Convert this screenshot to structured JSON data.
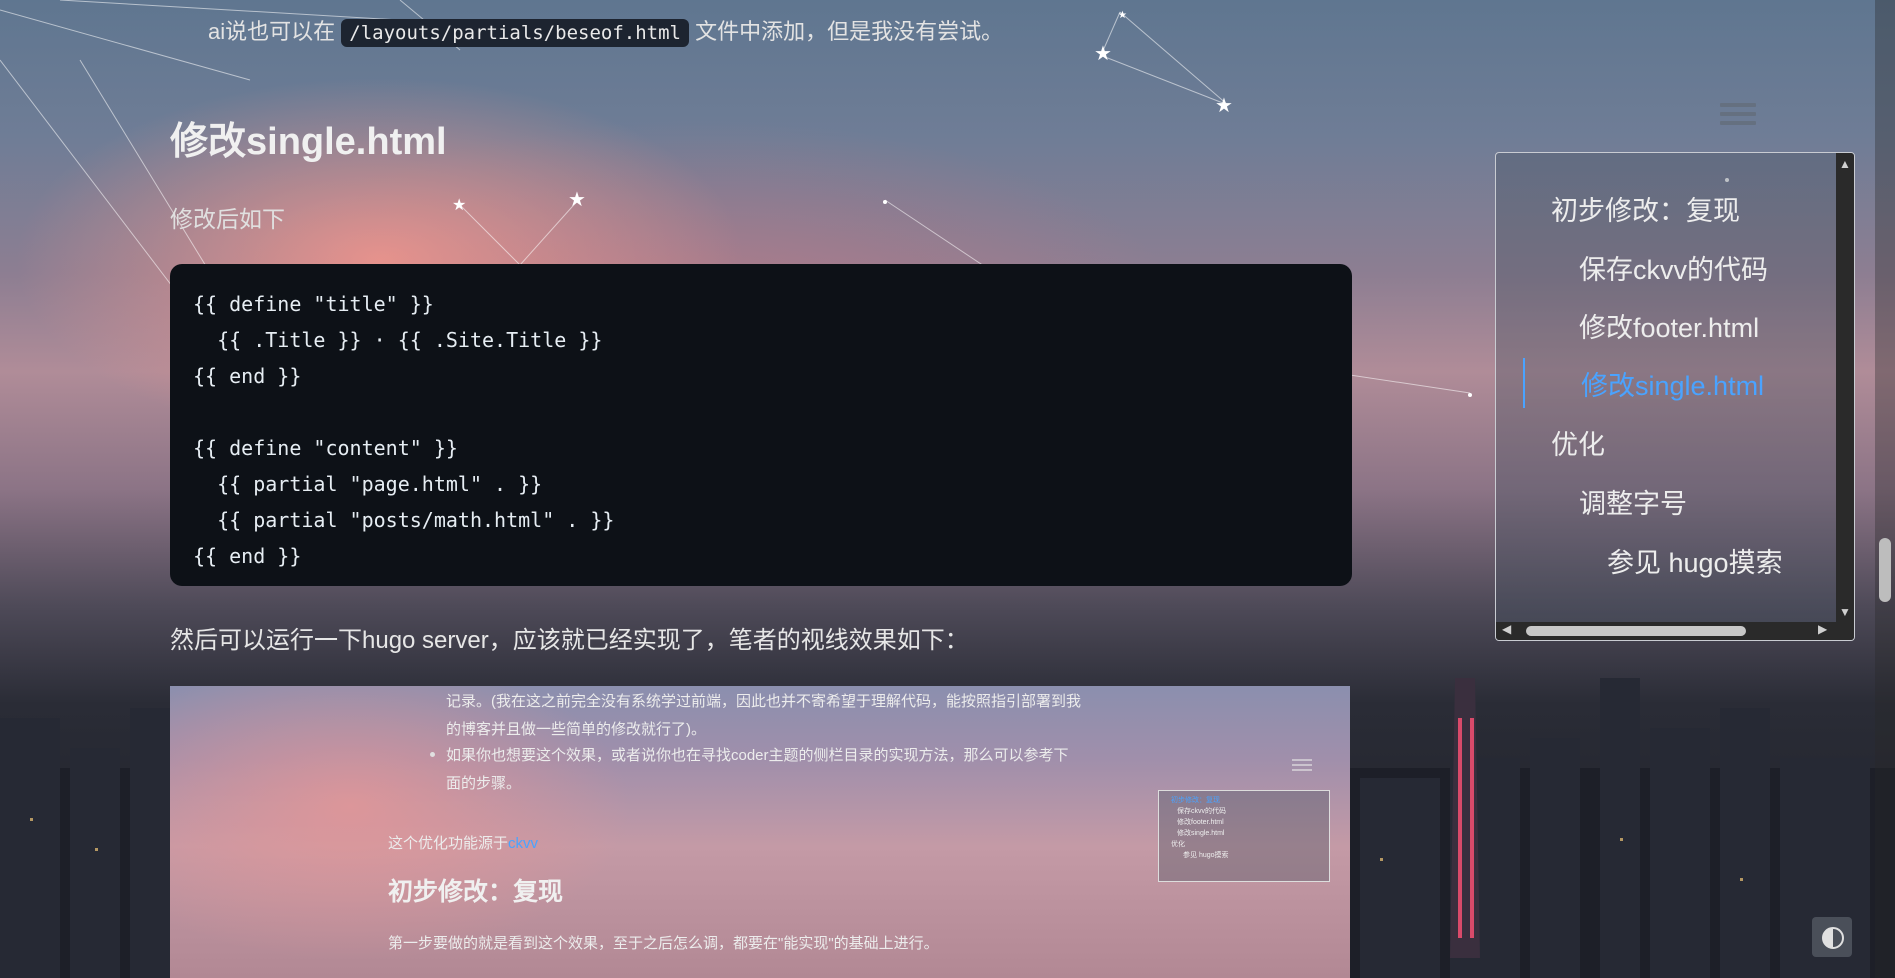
{
  "top": {
    "prefix": "ai说也可以在",
    "code": "/layouts/partials/beseof.html",
    "suffix": "文件中添加，但是我没有尝试。"
  },
  "section": {
    "title": "修改single.html",
    "intro": "修改后如下"
  },
  "code_lines": [
    "{{ define \"title\" }}",
    "  {{ .Title }} · {{ .Site.Title }}",
    "{{ end }}",
    "",
    "{{ define \"content\" }}",
    "  {{ partial \"page.html\" . }}",
    "  {{ partial \"posts/math.html\" . }}",
    "{{ end }}"
  ],
  "after_code": "然后可以运行一下hugo server，应该就已经实现了，笔者的视线效果如下：",
  "toc": {
    "items": [
      {
        "label": "初步修改：复现"
      },
      {
        "label": "保存ckvv的代码"
      },
      {
        "label": "修改footer.html"
      },
      {
        "label": "修改single.html"
      },
      {
        "label": "优化"
      },
      {
        "label": "调整字号"
      },
      {
        "label": "参见 hugo摸索"
      }
    ],
    "active_index": 3
  },
  "embedded": {
    "line1": "记录。(我在这之前完全没有系统学过前端，因此也并不寄希望于理解代码，能按照指引部署到我",
    "line2": "的博客并且做一些简单的修改就行了)。",
    "bullet1": "如果你也想要这个效果，或者说你也在寻找coder主题的侧栏目录的实现方法，那么可以参考下",
    "bullet1b": "面的步骤。",
    "source_prefix": "这个优化功能源于",
    "source_link": "ckvv",
    "heading": "初步修改：复现",
    "para": "第一步要做的就是看到这个效果，至于之后怎么调，都要在\"能实现\"的基础上进行。",
    "mini_toc": [
      "初步修改：复现",
      "保存ckvv的代码",
      "修改footer.html",
      "修改single.html",
      "优化",
      "参见 hugo摸索"
    ]
  },
  "icons": {
    "menu": "hamburger-menu-icon",
    "theme": "contrast-toggle-icon"
  },
  "colors": {
    "accent": "#4aa3ff",
    "code_bg": "#0d1117"
  }
}
